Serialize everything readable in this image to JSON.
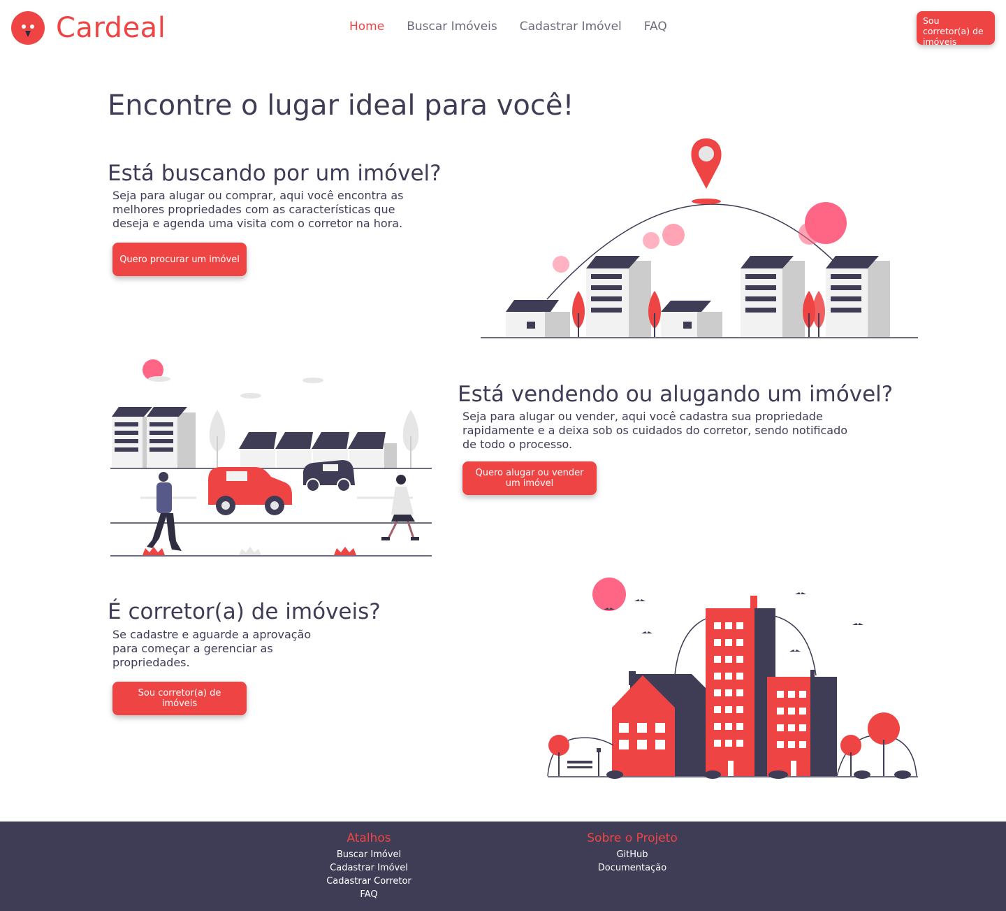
{
  "brand": {
    "name": "Cardeal",
    "accent_color": "#ef4444",
    "dark_color": "#3f3d56"
  },
  "nav": {
    "items": [
      {
        "label": "Home",
        "active": true
      },
      {
        "label": "Buscar Imóveis",
        "active": false
      },
      {
        "label": "Cadastrar Imóvel",
        "active": false
      },
      {
        "label": "FAQ",
        "active": false
      }
    ],
    "cta_label": "Sou corretor(a) de imóveis"
  },
  "hero": {
    "title": "Encontre o lugar ideal para você!"
  },
  "sections": [
    {
      "title": "Está buscando por um imóvel?",
      "text": "Seja para alugar ou comprar, aqui você encontra as melhores propriedades com as características que deseja e agenda uma visita com o corretor na hora.",
      "button": "Quero procurar um imóvel",
      "illustration": "city-location-pin-illustration"
    },
    {
      "title": "Está vendendo ou alugando um imóvel?",
      "text": "Seja para alugar ou vender, aqui você cadastra sua propriedade rapidamente e a deixa sob os cuidados do corretor, sendo notificado de todo o processo.",
      "button": "Quero alugar ou vender um imóvel",
      "illustration": "street-people-cars-illustration"
    },
    {
      "title": "É corretor(a) de imóveis?",
      "text": "Se cadastre e aguarde a aprovação para começar a gerenciar as propriedades.",
      "button": "Sou corretor(a) de imóveis",
      "illustration": "red-buildings-illustration"
    }
  ],
  "footer": {
    "shortcuts": {
      "title": "Atalhos",
      "links": [
        "Buscar Imóvel",
        "Cadastrar Imóvel",
        "Cadastrar Corretor",
        "FAQ"
      ]
    },
    "about": {
      "title": "Sobre o Projeto",
      "links": [
        "GitHub",
        "Documentação"
      ]
    }
  }
}
